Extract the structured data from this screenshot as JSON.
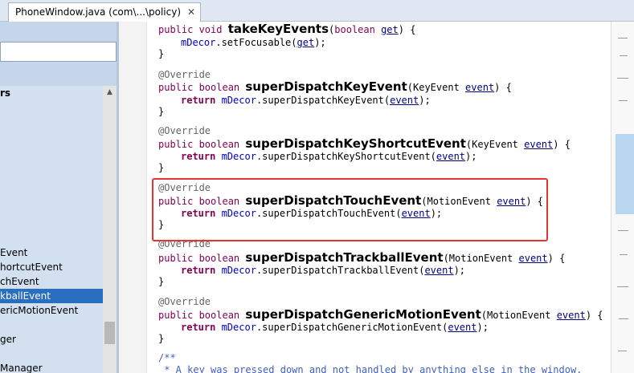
{
  "tab": {
    "title": "PhoneWindow.java (com\\...\\policy)",
    "close": "✕"
  },
  "left_panel": {
    "items": [
      {
        "text": "rs",
        "bold": true,
        "selected": false
      },
      {
        "text": "Event",
        "bold": false,
        "selected": false
      },
      {
        "text": "hortcutEvent",
        "bold": false,
        "selected": false
      },
      {
        "text": "chEvent",
        "bold": false,
        "selected": false
      },
      {
        "text": "kballEvent",
        "bold": false,
        "selected": true
      },
      {
        "text": "ericMotionEvent",
        "bold": false,
        "selected": false
      },
      {
        "text": "ger",
        "bold": false,
        "selected": false
      },
      {
        "text": "Manager",
        "bold": false,
        "selected": false
      }
    ],
    "scroll_up": "▲"
  },
  "code": {
    "l1": {
      "kw": "public void ",
      "name": "takeKeyEvents",
      "open": "(",
      "type": "boolean ",
      "param": "get",
      "close": ") {"
    },
    "l2": {
      "field": "mDecor",
      "rest": ".setFocusable(",
      "param": "get",
      "end": ");"
    },
    "l3": "}",
    "l5": "@Override",
    "l6": {
      "kw": "public boolean ",
      "name": "superDispatchKeyEvent",
      "open": "(KeyEvent ",
      "param": "event",
      "close": ") {"
    },
    "l7": {
      "ret": "return ",
      "field": "mDecor",
      "rest": ".superDispatchKeyEvent(",
      "param": "event",
      "end": ");"
    },
    "l8": "}",
    "l10": "@Override",
    "l11": {
      "kw": "public boolean ",
      "name": "superDispatchKeyShortcutEvent",
      "open": "(KeyEvent ",
      "param": "event",
      "close": ") {"
    },
    "l12": {
      "ret": "return ",
      "field": "mDecor",
      "rest": ".superDispatchKeyShortcutEvent(",
      "param": "event",
      "end": ");"
    },
    "l13": "}",
    "l15": "@Override",
    "l16": {
      "kw": "public boolean ",
      "name": "superDispatchTouchEvent",
      "open": "(MotionEvent ",
      "param": "event",
      "close": ") {"
    },
    "l17": {
      "ret": "return ",
      "field": "mDecor",
      "rest": ".superDispatchTouchEvent(",
      "param": "event",
      "end": ");"
    },
    "l18": "}",
    "l19": "@Override",
    "l20": {
      "kw": "public boolean ",
      "name": "superDispatchTrackballEvent",
      "open": "(MotionEvent ",
      "param": "event",
      "close": ") {"
    },
    "l21": {
      "ret": "return ",
      "field": "mDecor",
      "rest": ".superDispatchTrackballEvent(",
      "param": "event",
      "end": ");"
    },
    "l22": "}",
    "l24": "@Override",
    "l25": {
      "kw": "public boolean ",
      "name": "superDispatchGenericMotionEvent",
      "open": "(MotionEvent ",
      "param": "event",
      "close": ") {"
    },
    "l26": {
      "ret": "return ",
      "field": "mDecor",
      "rest": ".superDispatchGenericMotionEvent(",
      "param": "event",
      "end": ");"
    },
    "l27": "}",
    "l29": "/**",
    "l30": " * A key was pressed down and not handled by anything else in the window."
  },
  "colors": {
    "keyword": "#7f0055",
    "annotation": "#646464",
    "field": "#0000c0",
    "comment": "#3f5fbf",
    "highlight_box": "#e3342f",
    "selection": "#2a6fbf"
  }
}
